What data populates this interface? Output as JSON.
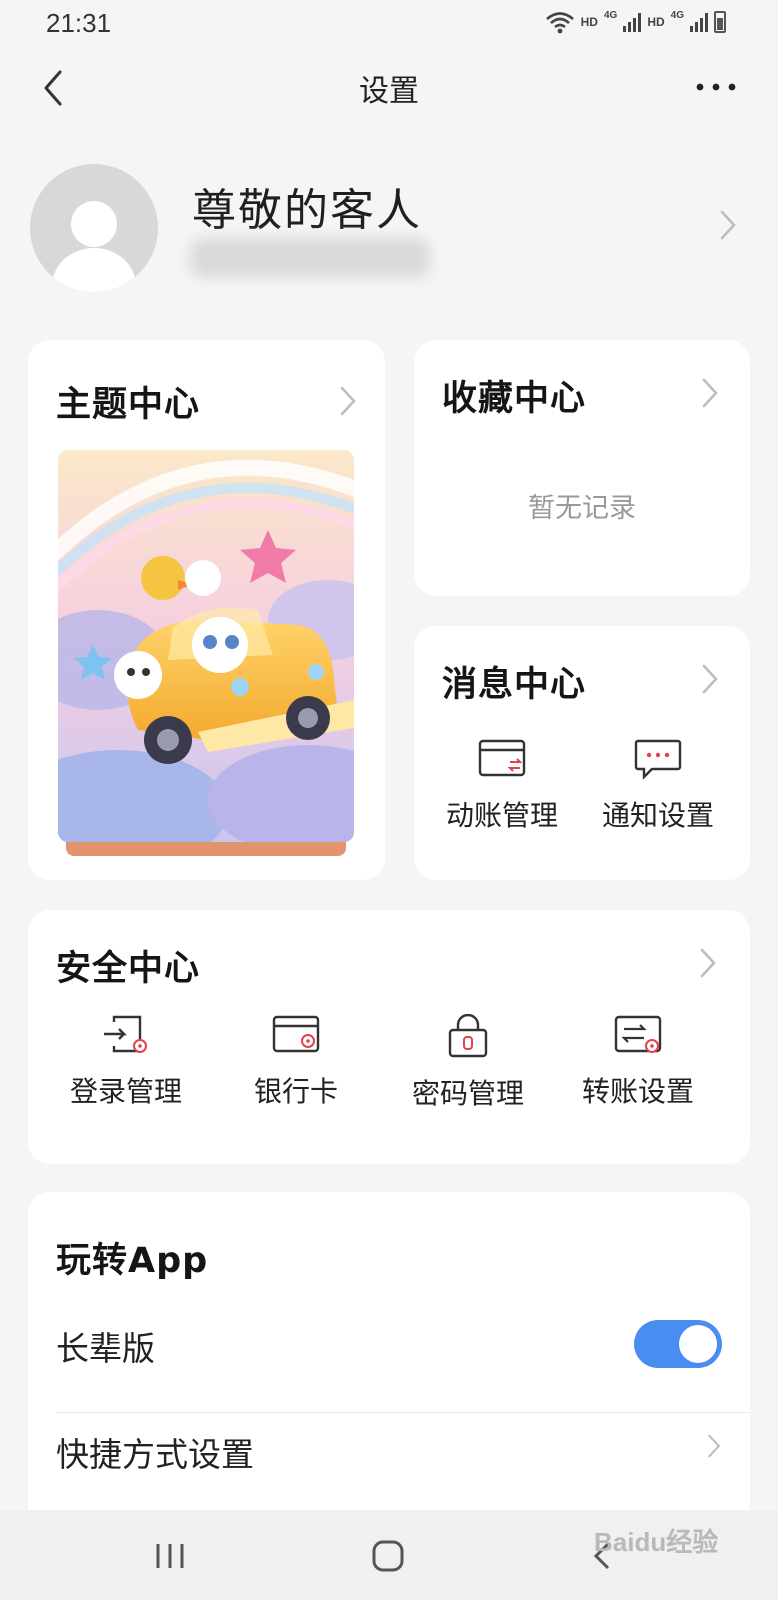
{
  "status_bar": {
    "time": "21:31",
    "network_labels": [
      "HD",
      "4G",
      "HD",
      "4G"
    ]
  },
  "header": {
    "title": "设置"
  },
  "profile": {
    "name": "尊敬的客人"
  },
  "theme_center": {
    "title": "主题中心"
  },
  "favorites_center": {
    "title": "收藏中心",
    "empty_text": "暂无记录"
  },
  "message_center": {
    "title": "消息中心",
    "items": [
      {
        "label": "动账管理",
        "icon": "card-transfer-icon"
      },
      {
        "label": "通知设置",
        "icon": "chat-bubble-icon"
      }
    ]
  },
  "security_center": {
    "title": "安全中心",
    "items": [
      {
        "label": "登录管理",
        "icon": "login-icon"
      },
      {
        "label": "银行卡",
        "icon": "bank-card-icon"
      },
      {
        "label": "密码管理",
        "icon": "lock-icon"
      },
      {
        "label": "转账设置",
        "icon": "transfer-icon"
      }
    ]
  },
  "play_app": {
    "title": "玩转App",
    "rows": [
      {
        "label": "长辈版",
        "control": "toggle",
        "enabled": true
      },
      {
        "label": "快捷方式设置",
        "control": "chevron"
      }
    ]
  },
  "watermark": "Baidu经验",
  "colors": {
    "accent": "#4a8df0",
    "icon_red": "#e6404a",
    "background": "#f5f5f7",
    "card": "#ffffff"
  }
}
